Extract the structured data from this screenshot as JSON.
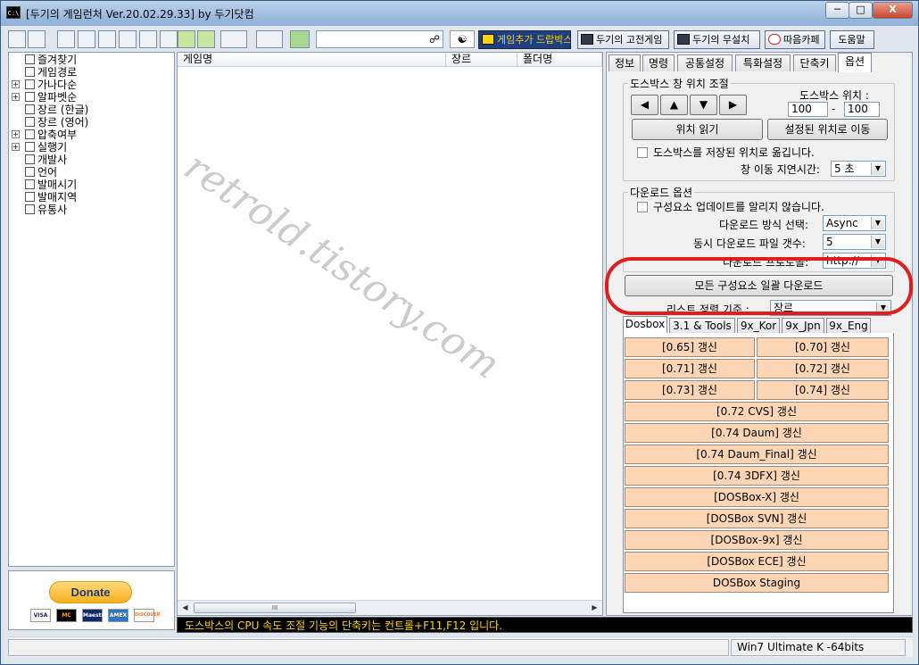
{
  "window": {
    "title": "[두기의 게임런처 Ver.20.02.29.33] by 두기닷컴",
    "icon": "C:\\",
    "minimize": "─",
    "maximize": "□",
    "close": "X"
  },
  "toolbar": {
    "search_value": "",
    "search_icon": "binoculars-icon",
    "flag_icon": "korea-flag-icon",
    "buttons": [
      {
        "label": "게임추가 드랍박스",
        "icon": "game-add-icon"
      },
      {
        "label": "두기의 고전게임",
        "icon": "dos-prompt-icon"
      },
      {
        "label": "두기의 무설치",
        "icon": "box-icon"
      },
      {
        "label": "따음카페",
        "icon": "daum-icon"
      },
      {
        "label": "도움말",
        "icon": ""
      }
    ]
  },
  "tree": {
    "items": [
      {
        "label": "즐겨찾기",
        "expandable": false
      },
      {
        "label": "게임경로",
        "expandable": false
      },
      {
        "label": "가나다순",
        "expandable": true
      },
      {
        "label": "알파벳순",
        "expandable": true
      },
      {
        "label": "장르 (한글)",
        "expandable": false
      },
      {
        "label": "장르 (영어)",
        "expandable": false
      },
      {
        "label": "압축여부",
        "expandable": true
      },
      {
        "label": "실행기",
        "expandable": true
      },
      {
        "label": "개발사",
        "expandable": false
      },
      {
        "label": "언어",
        "expandable": false
      },
      {
        "label": "발매시기",
        "expandable": false
      },
      {
        "label": "발매지역",
        "expandable": false
      },
      {
        "label": "유통사",
        "expandable": false
      }
    ]
  },
  "donate": {
    "button_label": "Donate",
    "cards": [
      "VISA",
      "MC",
      "Maestro",
      "AMEX",
      "DISCOVER"
    ]
  },
  "list": {
    "columns": [
      "게임명",
      "장르",
      "폴더명"
    ],
    "rows": [],
    "scroll_thumb": "III"
  },
  "watermark": "retrold.tistory.com",
  "right_panel": {
    "tabs": [
      "정보",
      "명령",
      "공통설정",
      "특화설정",
      "단축키",
      "옵션"
    ],
    "active_tab": "옵션",
    "dosbox_window": {
      "legend": "도스박스 창 위치 조절",
      "position_label": "도스박스 위치 :",
      "x_value": "100",
      "separator": "-",
      "y_value": "100",
      "arrows": [
        "◀",
        "▲",
        "▼",
        "▶"
      ],
      "read_button": "위치 읽기",
      "move_button": "설정된 위치로 이동",
      "save_checkbox": "도스박스를 저장된 위치로 옮깁니다.",
      "delay_label": "창 이동 지연시간:",
      "delay_value": "5 초"
    },
    "download": {
      "legend": "다운로드 옵션",
      "no_notify_checkbox": "구성요소 업데이트를 알리지 않습니다.",
      "method_label": "다운로드 방식 선택:",
      "method_value": "Async",
      "concurrent_label": "동시 다운로드 파일 갯수:",
      "concurrent_value": "5",
      "protocol_label": "다운로드 프로토콜:",
      "protocol_value": "http://"
    },
    "bulk_download_button": "모든 구성요소 일괄 다운로드",
    "sort_label": "리스트 정렬 기준 :",
    "sort_value": "장르",
    "sub_tabs": [
      "Dosbox",
      "3.1 & Tools",
      "9x_Kor",
      "9x_Jpn",
      "9x_Eng"
    ],
    "active_sub_tab": "Dosbox",
    "update_pairs": [
      [
        "[0.65] 갱신",
        "[0.70] 갱신"
      ],
      [
        "[0.71] 갱신",
        "[0.72] 갱신"
      ],
      [
        "[0.73] 갱신",
        "[0.74] 갱신"
      ]
    ],
    "update_full": [
      "[0.72 CVS] 갱신",
      "[0.74 Daum] 갱신",
      "[0.74 Daum_Final] 갱신",
      "[0.74 3DFX] 갱신",
      "[DOSBox-X] 갱신",
      "[DOSBox SVN] 갱신",
      "[DOSBox-9x] 갱신",
      "[DOSBox ECE] 갱신",
      "DOSBox Staging"
    ]
  },
  "status_line": "도스박스의 CPU 속도 조절 기능의 단축키는 컨트롤+F11,F12 입니다.",
  "status_bar": {
    "left": "",
    "os": "Win7 Ultimate K -64bits"
  },
  "colors": {
    "update_button": "#fcd5b4",
    "highlight_ring": "#e21b1b",
    "status_text": "#ffd200"
  }
}
